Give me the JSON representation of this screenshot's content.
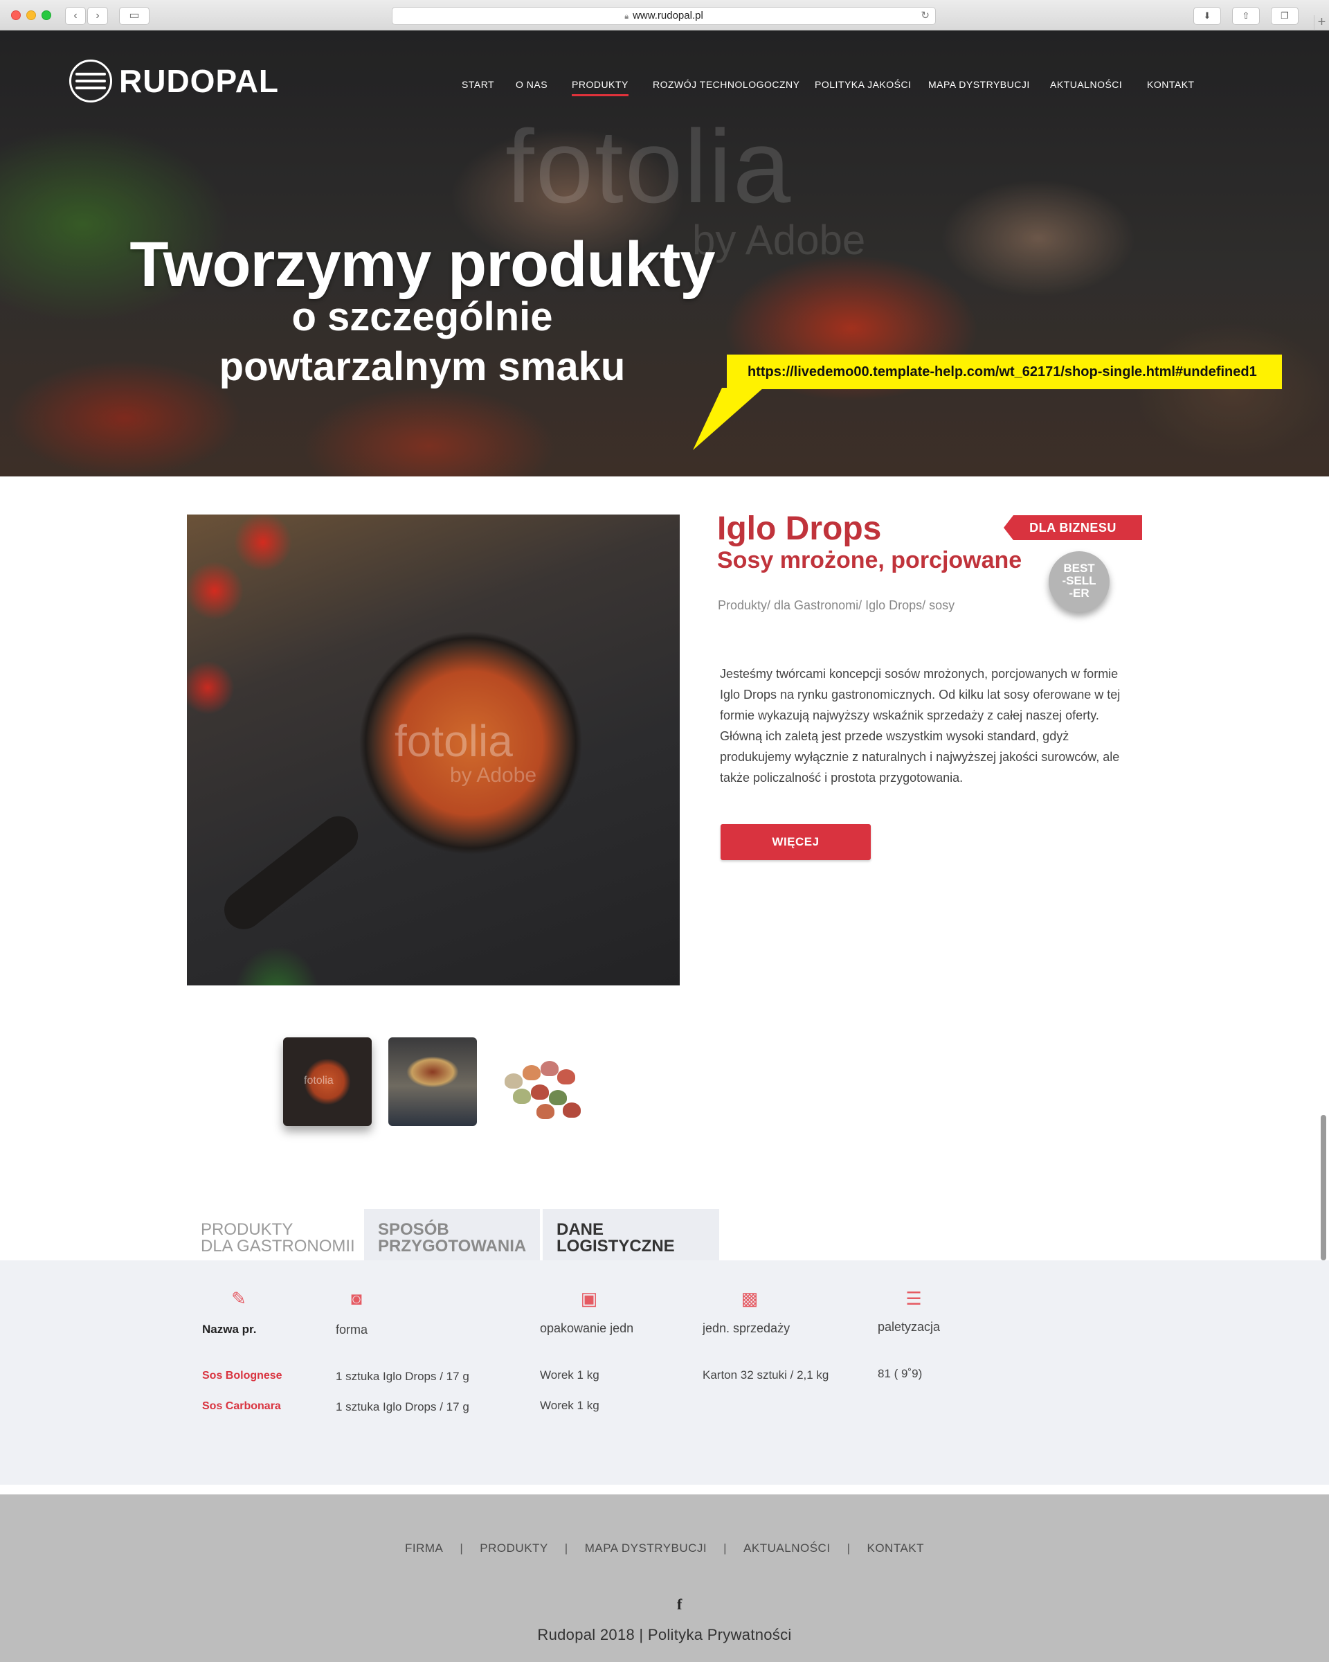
{
  "browser": {
    "url": "www.rudopal.pl"
  },
  "site": {
    "logo_text": "RUDOPAL",
    "nav": [
      {
        "label": "START"
      },
      {
        "label": "O NAS"
      },
      {
        "label": "PRODUKTY",
        "active": true
      },
      {
        "label": "ROZWÓJ TECHNOLOGOCZNY"
      },
      {
        "label": "POLITYKA JAKOŚCI"
      },
      {
        "label": "MAPA DYSTRYBUCJI"
      },
      {
        "label": "AKTUALNOŚCI"
      },
      {
        "label": "KONTAKT"
      }
    ]
  },
  "hero": {
    "title": "Tworzymy produkty",
    "subtitle_line1": "o szczególnie",
    "subtitle_line2": "powtarzalnym smaku",
    "watermark": "fotolia",
    "watermark_sub": "by Adobe"
  },
  "callout": {
    "text": "https://livedemo00.template-help.com/wt_62171/shop-single.html#undefined1"
  },
  "product": {
    "title": "Iglo Drops",
    "subtitle": "Sosy mrożone, porcjowane",
    "badge_business": "DLA BIZNESU",
    "badge_best_1": "BEST",
    "badge_best_2": "-SELL",
    "badge_best_3": "-ER",
    "breadcrumb": "Produkty/ dla Gastronomi/ Iglo Drops/ sosy",
    "description": "Jesteśmy twórcami koncepcji sosów mrożonych, porcjowanych w formie Iglo Drops na rynku gastronomicznych. Od kilku lat  sosy oferowane w tej formie wykazują najwyższy wskaźnik sprzedaży z całej naszej oferty. Główną ich zaletą jest przede wszystkim wysoki standard, gdyż produkujemy wyłącznie z naturalnych i najwyższej jakości surowców, ale także policzalność i prostota przygotowania.",
    "more_label": "WIĘCEJ",
    "image_watermark": "fotolia",
    "image_watermark_sub": "by Adobe",
    "thumb_watermark": "fotolia"
  },
  "tabs": [
    {
      "line1": "PRODUKTY",
      "line2": "DLA GASTRONOMII"
    },
    {
      "line1": "SPOSÓB",
      "line2": "PRZYGOTOWANIA"
    },
    {
      "line1": "DANE",
      "line2": "LOGISTYCZNE"
    }
  ],
  "table": {
    "columns": [
      {
        "label": "Nazwa pr.",
        "icon": "document-pen-icon"
      },
      {
        "label": "forma",
        "icon": "scale-icon"
      },
      {
        "label": "opakowanie jedn",
        "icon": "calendar-one-icon"
      },
      {
        "label": "jedn. sprzedaży",
        "icon": "box-icon"
      },
      {
        "label": "paletyzacja",
        "icon": "pallet-list-icon"
      }
    ],
    "rows": [
      {
        "name": "Sos Bolognese",
        "form": "1 sztuka Iglo Drops / 17 g",
        "unit": "Worek 1 kg",
        "sale_unit": "Karton 32 sztuki / 2,1 kg",
        "pallet": "81 ( 9˚9)"
      },
      {
        "name": "Sos Carbonara",
        "form": "1 sztuka Iglo Drops / 17 g",
        "unit": "Worek 1 kg",
        "sale_unit": "",
        "pallet": ""
      }
    ]
  },
  "footer": {
    "nav": [
      "FIRMA",
      "PRODUKTY",
      "MAPA DYSTRYBUCJI",
      "AKTUALNOŚCI",
      "KONTAKT"
    ],
    "separator": "|",
    "facebook_glyph": "f",
    "copyright": "Rudopal 2018 | Polityka Prywatności"
  },
  "colors": {
    "accent": "#d9333f",
    "callout": "#fff200",
    "panel": "#eff1f5",
    "footer": "#bdbdbd"
  }
}
